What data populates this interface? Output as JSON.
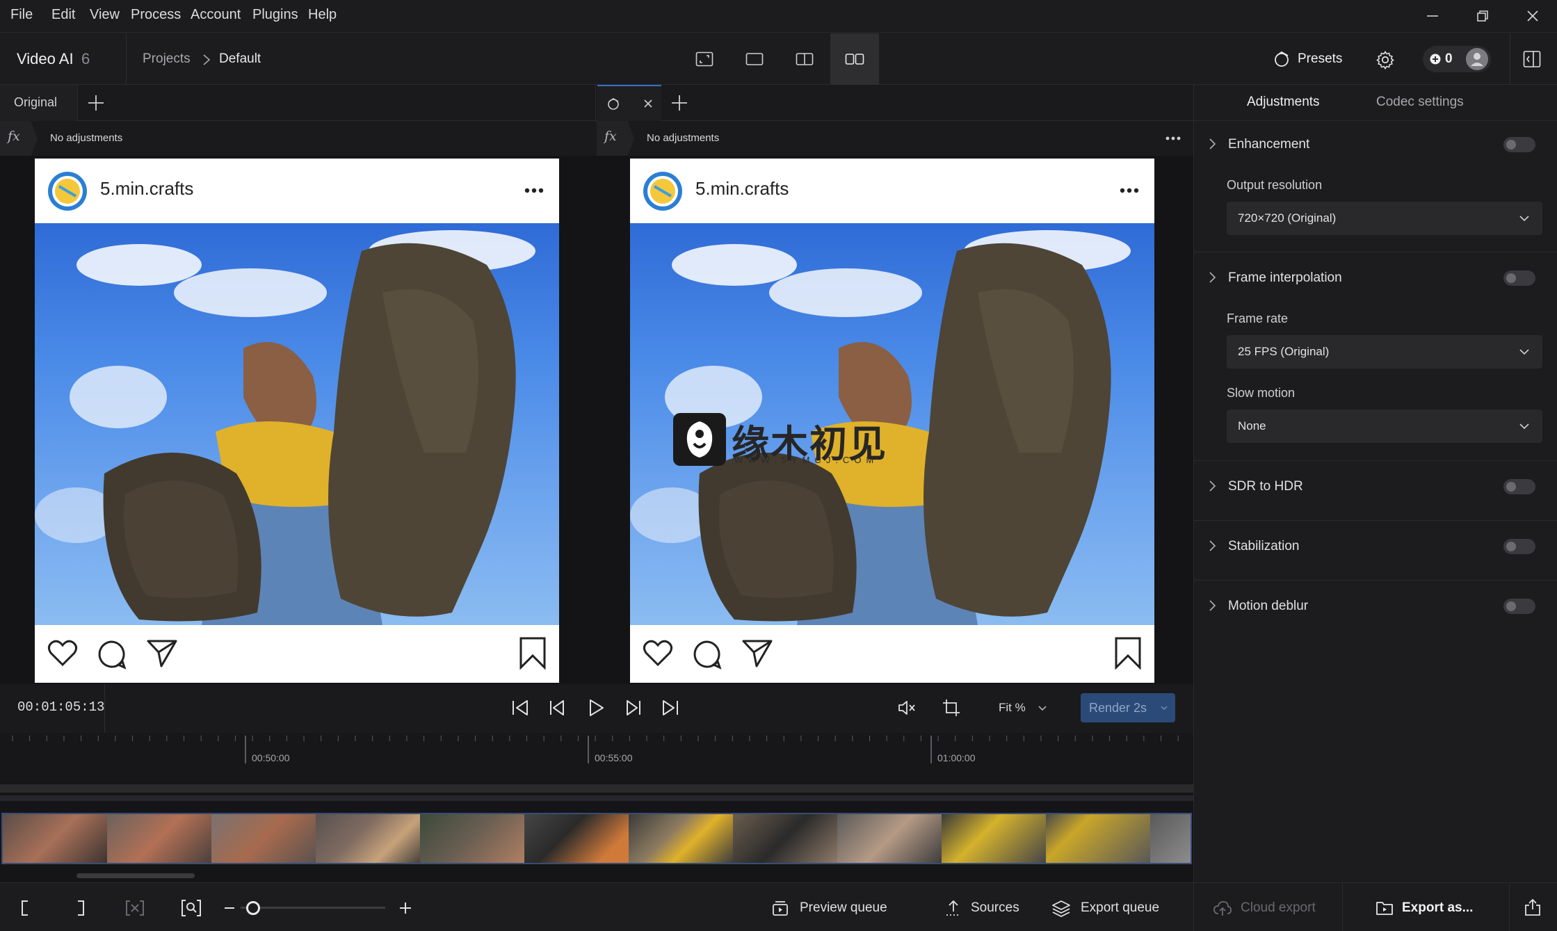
{
  "menu": [
    "File",
    "Edit",
    "View",
    "Process",
    "Account",
    "Plugins",
    "Help"
  ],
  "app": {
    "title": "Video AI",
    "version": "6"
  },
  "breadcrumb": {
    "projects": "Projects",
    "current": "Default"
  },
  "header": {
    "presets_label": "Presets",
    "credits": "0"
  },
  "left_pane": {
    "tab_label": "Original",
    "fx_text": "No adjustments"
  },
  "right_pane": {
    "fx_text": "No adjustments"
  },
  "post": {
    "username": "5.min.crafts"
  },
  "watermark": {
    "text": "缘木初见",
    "sub": "WWW.5YMCJ.COM"
  },
  "panel": {
    "tabs": [
      "Adjustments",
      "Codec settings"
    ],
    "enhancement": {
      "title": "Enhancement",
      "enabled": false
    },
    "output_resolution": {
      "label": "Output resolution",
      "value": "720×720 (Original)"
    },
    "frame_interpolation": {
      "title": "Frame interpolation",
      "enabled": false
    },
    "frame_rate": {
      "label": "Frame rate",
      "value": "25 FPS (Original)"
    },
    "slow_motion": {
      "label": "Slow motion",
      "value": "None"
    },
    "sdr_to_hdr": {
      "title": "SDR to HDR",
      "enabled": false
    },
    "stabilization": {
      "title": "Stabilization",
      "enabled": false
    },
    "motion_deblur": {
      "title": "Motion deblur",
      "enabled": false
    }
  },
  "transport": {
    "timecode": "00:01:05:13",
    "fit_label": "Fit %",
    "render_label": "Render 2s"
  },
  "ruler": {
    "marks": [
      "00:50:00",
      "00:55:00",
      "01:00:00"
    ]
  },
  "bottom": {
    "preview_queue": "Preview queue",
    "sources": "Sources",
    "export_queue": "Export queue",
    "cloud_export": "Cloud export",
    "export_as": "Export as..."
  },
  "colors": {
    "accent": "#3a5a8a",
    "panel_bg": "#1c1c1e",
    "toggle_off": "#3b3b3f"
  }
}
